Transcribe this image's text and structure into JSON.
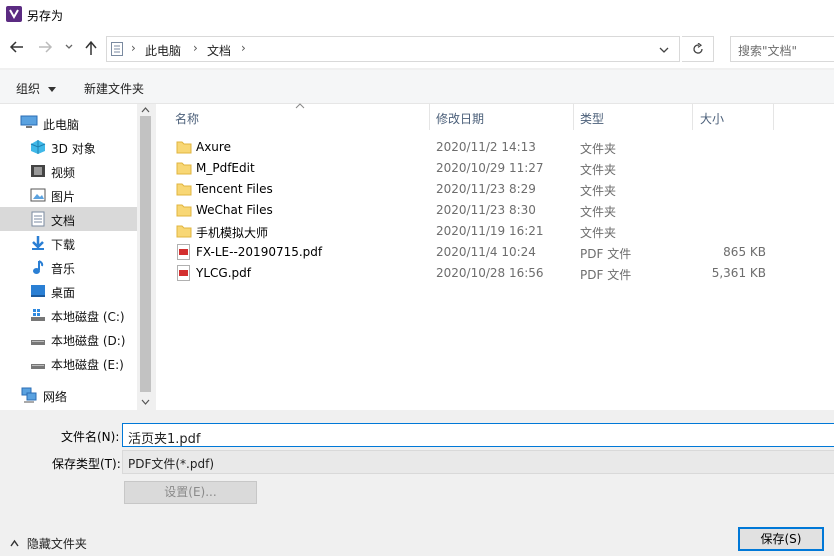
{
  "window": {
    "title": "另存为"
  },
  "address": {
    "crumbs": [
      "此电脑",
      "文档"
    ],
    "search_placeholder": "搜索\"文档\""
  },
  "toolbar": {
    "organize": "组织",
    "new_folder": "新建文件夹"
  },
  "nav": {
    "items": [
      {
        "label": "此电脑",
        "icon": "computer-icon"
      },
      {
        "label": "3D 对象",
        "icon": "3d-objects-icon"
      },
      {
        "label": "视频",
        "icon": "video-icon"
      },
      {
        "label": "图片",
        "icon": "pictures-icon"
      },
      {
        "label": "文档",
        "icon": "documents-icon",
        "selected": true
      },
      {
        "label": "下载",
        "icon": "download-icon"
      },
      {
        "label": "音乐",
        "icon": "music-icon"
      },
      {
        "label": "桌面",
        "icon": "desktop-icon"
      },
      {
        "label": "本地磁盘 (C:)",
        "icon": "drive-icon"
      },
      {
        "label": "本地磁盘 (D:)",
        "icon": "drive-icon"
      },
      {
        "label": "本地磁盘 (E:)",
        "icon": "drive-icon"
      },
      {
        "label": "网络",
        "icon": "network-icon"
      }
    ]
  },
  "columns": {
    "name": "名称",
    "date": "修改日期",
    "type": "类型",
    "size": "大小"
  },
  "files": [
    {
      "name": "Axure",
      "date": "2020/11/2 14:13",
      "type": "文件夹",
      "size": "",
      "icon": "folder-icon"
    },
    {
      "name": "M_PdfEdit",
      "date": "2020/10/29 11:27",
      "type": "文件夹",
      "size": "",
      "icon": "folder-icon"
    },
    {
      "name": "Tencent Files",
      "date": "2020/11/23 8:29",
      "type": "文件夹",
      "size": "",
      "icon": "folder-icon"
    },
    {
      "name": "WeChat Files",
      "date": "2020/11/23 8:30",
      "type": "文件夹",
      "size": "",
      "icon": "folder-icon"
    },
    {
      "name": "手机模拟大师",
      "date": "2020/11/19 16:21",
      "type": "文件夹",
      "size": "",
      "icon": "folder-icon"
    },
    {
      "name": "FX-LE--20190715.pdf",
      "date": "2020/11/4 10:24",
      "type": "PDF 文件",
      "size": "865 KB",
      "icon": "pdf-file-icon"
    },
    {
      "name": "YLCG.pdf",
      "date": "2020/10/28 16:56",
      "type": "PDF 文件",
      "size": "5,361 KB",
      "icon": "pdf-file-icon"
    }
  ],
  "form": {
    "filename_label": "文件名(N):",
    "filename_value": "活页夹1.pdf",
    "filetype_label": "保存类型(T):",
    "filetype_value": "PDF文件(*.pdf)",
    "settings_label": "设置(E)...",
    "hide_folders_label": "隐藏文件夹",
    "save_label": "保存(S)"
  },
  "colors": {
    "accent": "#0078d7",
    "folder": "#f8d775",
    "pdf": "#d32f2f",
    "selected": "#d9d9d9"
  }
}
